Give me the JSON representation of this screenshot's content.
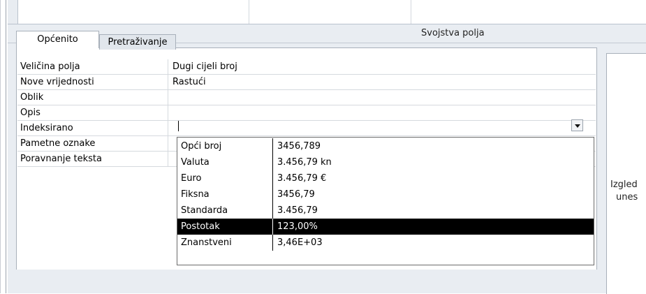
{
  "pane": {
    "title": "Svojstva polja"
  },
  "tabs": [
    {
      "label": "Općenito",
      "active": true
    },
    {
      "label": "Pretraživanje",
      "active": false
    }
  ],
  "properties": [
    {
      "name": "Veličina polja",
      "value": "Dugi cijeli broj"
    },
    {
      "name": "Nove vrijednosti",
      "value": "Rastući"
    },
    {
      "name": "Oblik",
      "value": ""
    },
    {
      "name": "Opis",
      "value": ""
    },
    {
      "name": "Indeksirano",
      "value": ""
    },
    {
      "name": "Pametne oznake",
      "value": ""
    },
    {
      "name": "Poravnanje teksta",
      "value": ""
    }
  ],
  "format_dropdown": {
    "selected": "Postotak",
    "options": [
      {
        "name": "Opći broj",
        "example": "3456,789"
      },
      {
        "name": "Valuta",
        "example": "3.456,79 kn"
      },
      {
        "name": "Euro",
        "example": "3.456,79 €"
      },
      {
        "name": "Fiksna",
        "example": "3456,79"
      },
      {
        "name": "Standarda",
        "example": "3.456,79"
      },
      {
        "name": "Postotak",
        "example": "123,00%"
      },
      {
        "name": "Znanstveni",
        "example": "3,46E+03"
      }
    ]
  },
  "help": {
    "line1": "Izgled",
    "line2": "unes"
  },
  "icons": {
    "dropdown": "chevron-down-icon"
  }
}
